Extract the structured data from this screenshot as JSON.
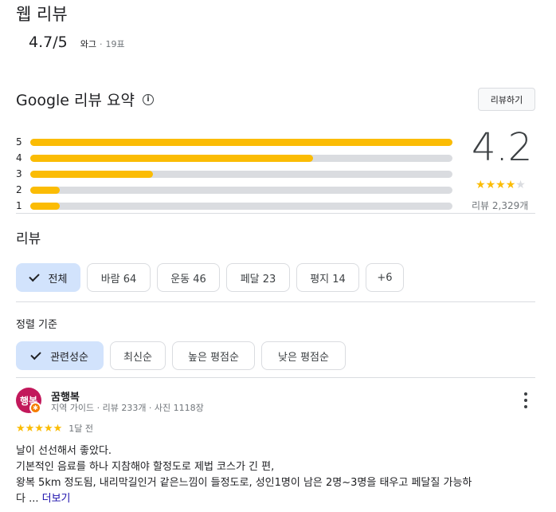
{
  "web_reviews": {
    "title": "웹 리뷰",
    "score": "4.7/5",
    "source": "와그",
    "separator": "·",
    "votes": "19표"
  },
  "summary": {
    "title": "Google 리뷰 요약",
    "write_review_label": "리뷰하기",
    "rating": "4.2",
    "stars_filled": 4,
    "stars_total": 5,
    "review_count": "리뷰 2,329개",
    "distribution": [
      {
        "label": "5",
        "fraction": 1.0
      },
      {
        "label": "4",
        "fraction": 0.67
      },
      {
        "label": "3",
        "fraction": 0.29
      },
      {
        "label": "2",
        "fraction": 0.07
      },
      {
        "label": "1",
        "fraction": 0.07
      }
    ]
  },
  "reviews": {
    "heading": "리뷰",
    "topic_chips": [
      {
        "label": "전체",
        "selected": true
      },
      {
        "label": "바람 64",
        "selected": false
      },
      {
        "label": "운동 46",
        "selected": false
      },
      {
        "label": "페달 23",
        "selected": false
      },
      {
        "label": "평지 14",
        "selected": false
      },
      {
        "label": "+6",
        "selected": false
      }
    ],
    "sort_label": "정렬 기준",
    "sort_chips": [
      {
        "label": "관련성순",
        "selected": true
      },
      {
        "label": "최신순",
        "selected": false
      },
      {
        "label": "높은 평점순",
        "selected": false
      },
      {
        "label": "낮은 평점순",
        "selected": false
      }
    ],
    "items": [
      {
        "avatar_text": "행복",
        "name": "꿈행복",
        "meta": "지역 가이드 · 리뷰 233개 · 사진 1118장",
        "stars": "★★★★★",
        "date": "1달 전",
        "lines": [
          "날이 선선해서 좋았다.",
          "기본적인 음료를 하나 지참해야 할정도로 제법 코스가 긴 편,",
          "왕복 5km 정도됨, 내리막길인거 같은느낌이 들정도로, 성인1명이 남은 2명~3명을 태우고 페달질 가능하",
          "다 ..."
        ],
        "more_label": "더보기"
      }
    ]
  }
}
